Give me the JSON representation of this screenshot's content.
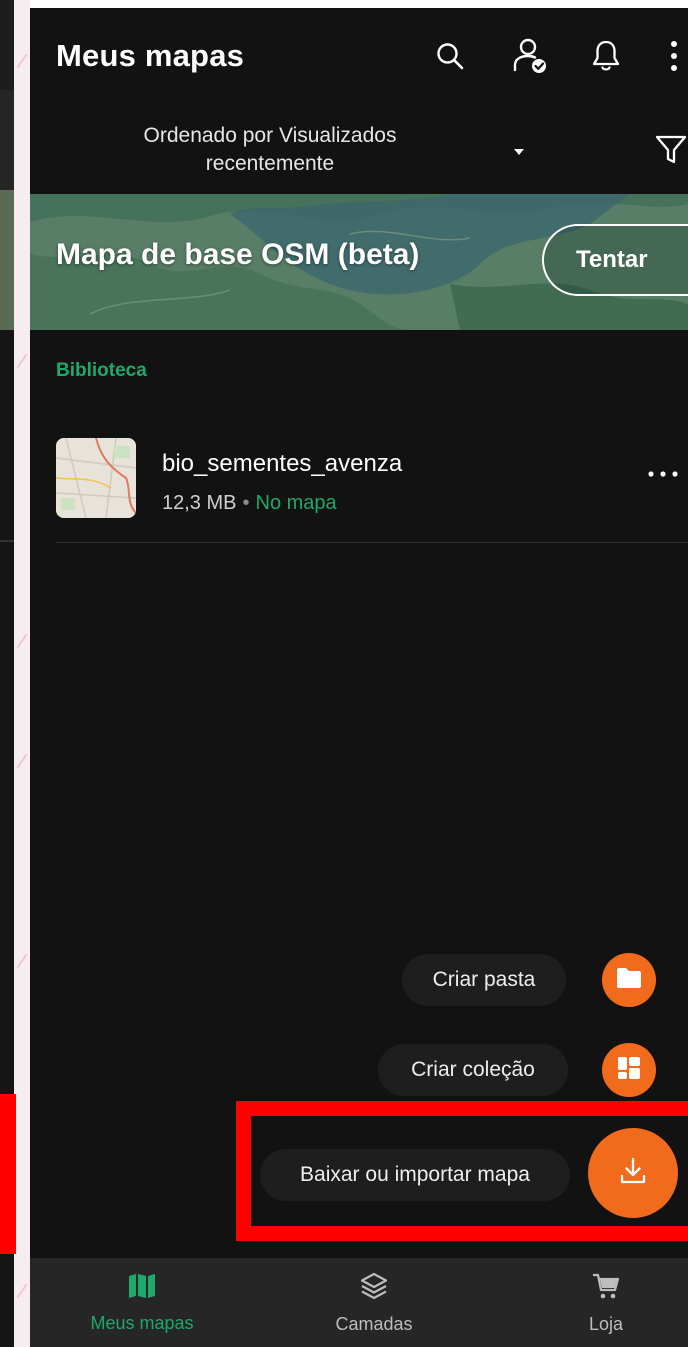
{
  "header": {
    "title": "Meus mapas",
    "icons": [
      "search-icon",
      "account-check-icon",
      "bell-icon",
      "more-vertical-icon"
    ]
  },
  "sort": {
    "label": "Ordenado por Visualizados recentemente",
    "caret_icon": "caret-down-icon",
    "filter_icon": "filter-icon"
  },
  "banner": {
    "title": "Mapa de base OSM (beta)",
    "button_label": "Tentar"
  },
  "library": {
    "section_label": "Biblioteca",
    "items": [
      {
        "name": "bio_sementes_avenza",
        "size": "12,3 MB",
        "status": "No mapa"
      }
    ]
  },
  "fab_menu": {
    "items": [
      {
        "label": "Criar pasta",
        "icon": "folder-icon"
      },
      {
        "label": "Criar coleção",
        "icon": "collection-icon"
      },
      {
        "label": "Baixar ou importar mapa",
        "icon": "download-icon"
      }
    ]
  },
  "bottom_nav": {
    "items": [
      {
        "label": "Meus mapas",
        "icon": "map-icon",
        "active": true
      },
      {
        "label": "Camadas",
        "icon": "layers-icon",
        "active": false
      },
      {
        "label": "Loja",
        "icon": "cart-icon",
        "active": false
      }
    ]
  },
  "colors": {
    "background": "#121212",
    "accent_green": "#1ea86b",
    "fab_orange": "#f26a1b",
    "highlight_red": "#ff0000",
    "nav_background": "#262626"
  }
}
